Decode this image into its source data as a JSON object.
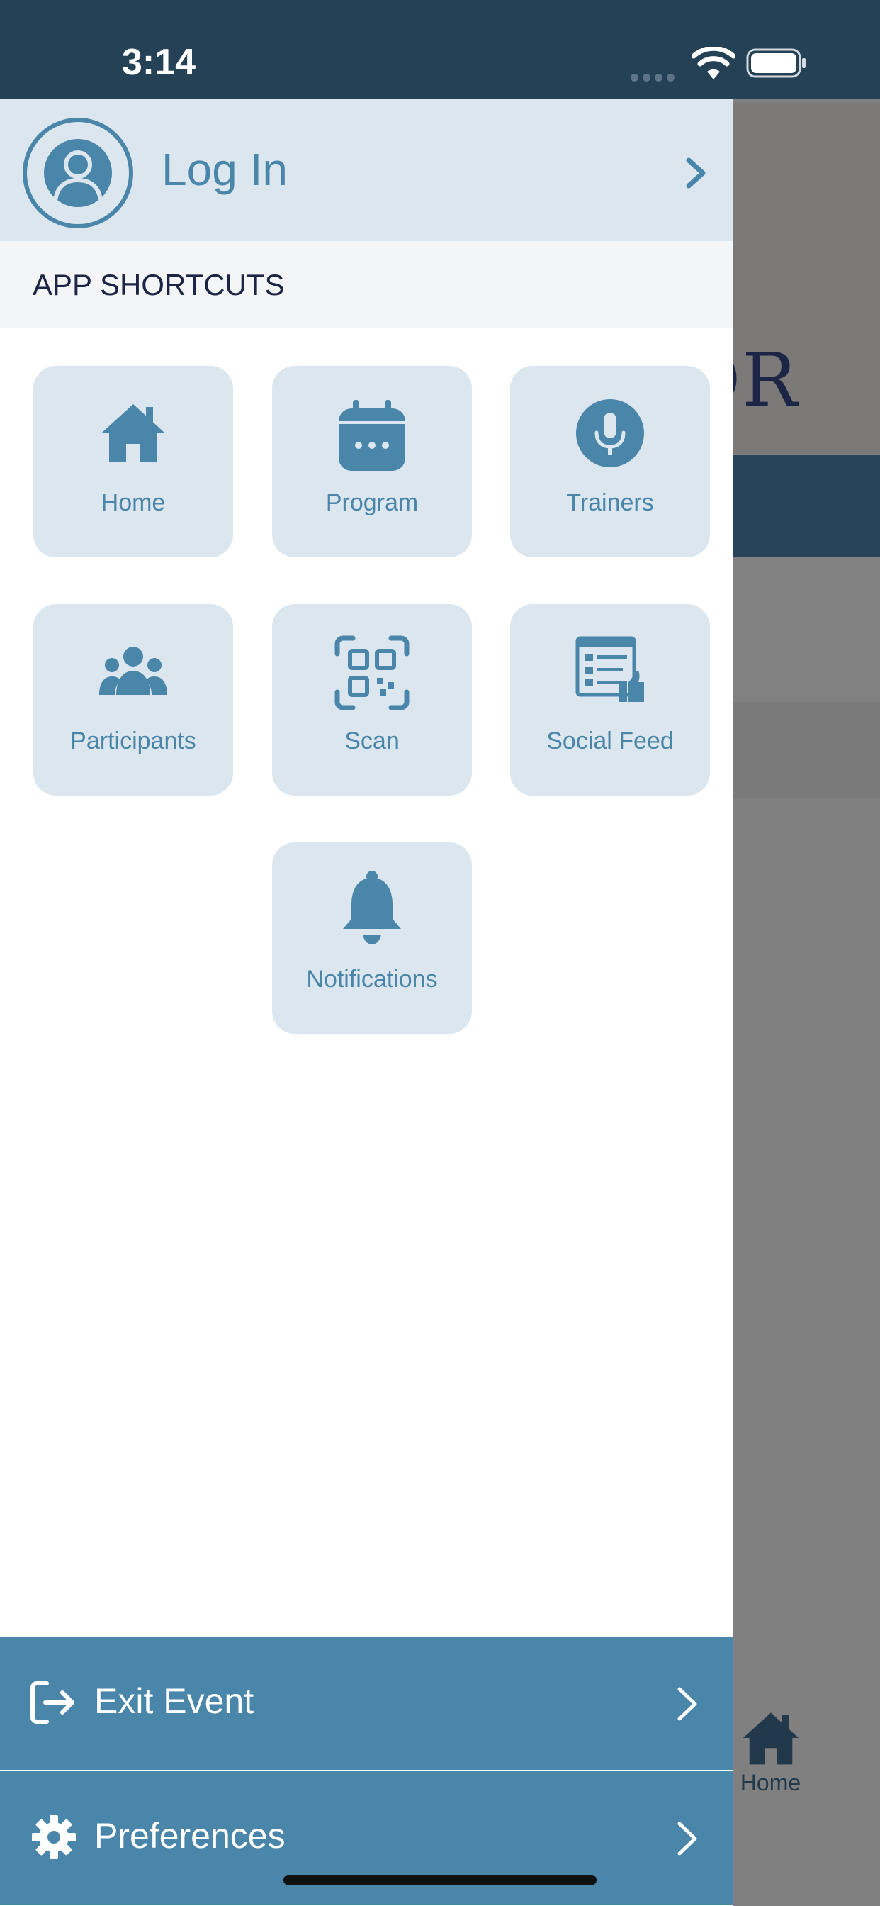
{
  "status_bar": {
    "time": "3:14"
  },
  "background_app": {
    "hero_text": "OR",
    "tab_home_label": "Home"
  },
  "drawer": {
    "login_label": "Log In",
    "shortcuts_title": "APP SHORTCUTS",
    "shortcuts": [
      {
        "label": "Home",
        "icon": "home-icon"
      },
      {
        "label": "Program",
        "icon": "calendar-icon"
      },
      {
        "label": "Trainers",
        "icon": "microphone-icon"
      },
      {
        "label": "Participants",
        "icon": "group-icon"
      },
      {
        "label": "Scan",
        "icon": "qr-scan-icon"
      },
      {
        "label": "Social Feed",
        "icon": "social-feed-icon"
      },
      {
        "label": "Notifications",
        "icon": "bell-icon"
      }
    ],
    "menu": [
      {
        "label": "Exit Event",
        "icon": "exit-icon"
      },
      {
        "label": "Preferences",
        "icon": "gear-icon"
      }
    ]
  },
  "colors": {
    "accent": "#4a86a9",
    "tile_bg": "#dce6ee",
    "header_dark": "#244155",
    "text_dark": "#1c2545"
  }
}
